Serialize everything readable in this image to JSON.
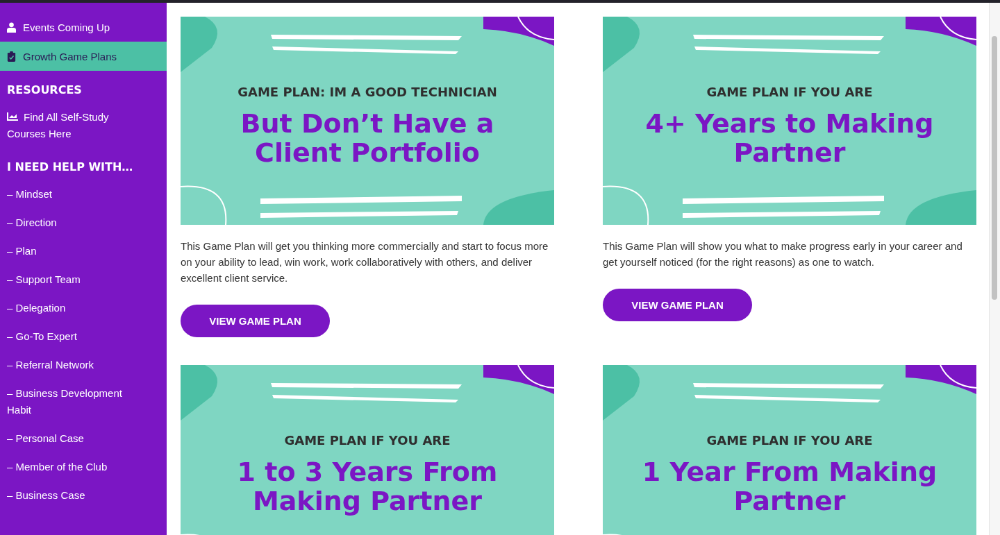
{
  "sidebar": {
    "nav": [
      {
        "label": "Events Coming Up",
        "selected": false
      },
      {
        "label": "Growth Game Plans",
        "selected": true
      }
    ],
    "resources_heading": "RESOURCES",
    "resources": [
      {
        "label": "Find All Self-Study Courses Here"
      }
    ],
    "help_heading": "I NEED HELP WITH…",
    "help_items": [
      {
        "label": "– Mindset"
      },
      {
        "label": "– Direction"
      },
      {
        "label": "– Plan"
      },
      {
        "label": "– Support Team"
      },
      {
        "label": "– Delegation"
      },
      {
        "label": "– Go-To Expert"
      },
      {
        "label": "– Referral Network"
      },
      {
        "label": "– Business Development Habit"
      },
      {
        "label": "– Personal Case"
      },
      {
        "label": "– Member of the Club"
      },
      {
        "label": "– Business Case"
      }
    ]
  },
  "cards": [
    {
      "eyebrow": "GAME PLAN: IM A GOOD TECHNICIAN",
      "title": "But Don’t Have a Client Portfolio",
      "description": "This Game Plan will get you thinking more commercially and start to focus more on your ability to lead, win work, work collaboratively with others, and deliver excellent client service.",
      "button": "VIEW GAME PLAN"
    },
    {
      "eyebrow": "GAME PLAN IF YOU ARE",
      "title": "4+ Years to Making Partner",
      "description": "This Game Plan will show you what to make progress early in your career and get yourself noticed (for the right reasons) as one to watch.",
      "button": "VIEW GAME PLAN"
    },
    {
      "eyebrow": "GAME PLAN IF YOU ARE",
      "title": "1 to 3 Years From Making Partner"
    },
    {
      "eyebrow": "GAME PLAN IF YOU ARE",
      "title": "1 Year From Making Partner"
    }
  ]
}
